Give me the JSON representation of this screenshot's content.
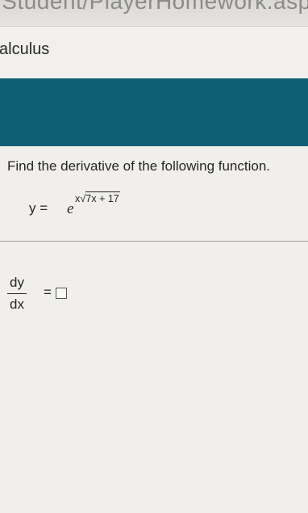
{
  "browser": {
    "url_fragment": "/Student/PlayerHomework.aspx?homework"
  },
  "header": {
    "course_title": "alculus"
  },
  "question": {
    "instruction": "Find the derivative of the following function.",
    "function_lhs": "y =",
    "function_base": "e",
    "exponent_coef": "x",
    "radical": "√",
    "radicand": "7x + 17"
  },
  "answer": {
    "derivative_numerator": "dy",
    "derivative_denominator": "dx",
    "equals": "=",
    "input_value": ""
  }
}
